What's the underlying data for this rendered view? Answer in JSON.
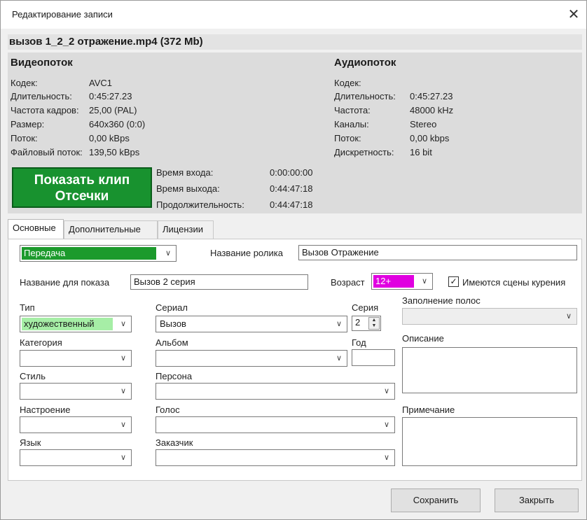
{
  "window": {
    "title": "Редактирование записи",
    "file_name": "вызов 1_2_2 отражение.mp4 (372 Mb)",
    "close_glyph": "✕"
  },
  "video": {
    "title": "Видеопоток",
    "rows": [
      {
        "label": "Кодек:",
        "value": "AVC1"
      },
      {
        "label": "Длительность:",
        "value": "0:45:27.23"
      },
      {
        "label": "Частота кадров:",
        "value": "25,00 (PAL)"
      },
      {
        "label": "Размер:",
        "value": "640x360 (0:0)"
      },
      {
        "label": "Поток:",
        "value": "0,00 kBps"
      },
      {
        "label": "Файловый поток:",
        "value": "139,50 kBps"
      }
    ]
  },
  "audio": {
    "title": "Аудиопоток",
    "rows": [
      {
        "label": "Кодек:",
        "value": ""
      },
      {
        "label": "Длительность:",
        "value": "0:45:27.23"
      },
      {
        "label": "Частота:",
        "value": "48000 kHz"
      },
      {
        "label": "Каналы:",
        "value": "Stereo"
      },
      {
        "label": "Поток:",
        "value": "0,00 kbps"
      },
      {
        "label": "Дискретность:",
        "value": "16 bit"
      }
    ]
  },
  "clip": {
    "button_line1": "Показать клип",
    "button_line2": "Отсечки",
    "button_color": "#18922f",
    "rows": [
      {
        "label": "Время входа:",
        "value": "0:00:00:00"
      },
      {
        "label": "Время выхода:",
        "value": "0:44:47:18"
      },
      {
        "label": "Продолжительность:",
        "value": "0:44:47:18"
      }
    ]
  },
  "tabs": [
    "Основные",
    "Дополнительные",
    "Лицензии"
  ],
  "form": {
    "program_type": {
      "value": "Передача",
      "color": "#1c9a2c"
    },
    "clip_name": {
      "label": "Название ролика",
      "value": "Вызов Отражение"
    },
    "display_name": {
      "label": "Название для показа",
      "value": "Вызов 2 серия"
    },
    "age": {
      "label": "Возраст",
      "value": "12+",
      "color": "#e000e0"
    },
    "smoking": {
      "label": "Имеются сцены курения",
      "checked": "✓"
    },
    "type": {
      "label": "Тип",
      "value": "художественный",
      "color": "#a6eea6"
    },
    "serial": {
      "label": "Сериал",
      "value": "Вызов"
    },
    "episode": {
      "label": "Серия",
      "value": "2"
    },
    "stripes": {
      "label": "Заполнение полос",
      "value": ""
    },
    "category": {
      "label": "Категория",
      "value": ""
    },
    "album": {
      "label": "Альбом",
      "value": ""
    },
    "year": {
      "label": "Год",
      "value": ""
    },
    "description": {
      "label": "Описание",
      "value": ""
    },
    "style": {
      "label": "Стиль",
      "value": ""
    },
    "person": {
      "label": "Персона",
      "value": ""
    },
    "mood": {
      "label": "Настроение",
      "value": ""
    },
    "voice": {
      "label": "Голос",
      "value": ""
    },
    "note": {
      "label": "Примечание",
      "value": ""
    },
    "language": {
      "label": "Язык",
      "value": ""
    },
    "customer": {
      "label": "Заказчик",
      "value": ""
    }
  },
  "buttons": {
    "save": "Сохранить",
    "close": "Закрыть"
  }
}
